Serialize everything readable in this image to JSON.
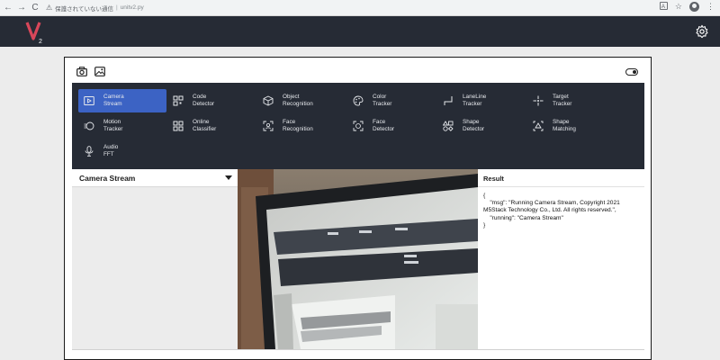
{
  "browser": {
    "back_icon": "←",
    "forward_icon": "→",
    "reload_icon": "C",
    "security_text": "保護されていない通信",
    "url": "unitv2.py"
  },
  "header": {
    "logo_subscript": "2"
  },
  "menu": {
    "items": [
      {
        "label": "Camera\nStream",
        "icon": "camera-stream-icon",
        "active": true
      },
      {
        "label": "Code\nDetector",
        "icon": "qr-code-icon",
        "active": false
      },
      {
        "label": "Object\nRecognition",
        "icon": "cube-icon",
        "active": false
      },
      {
        "label": "Color\nTracker",
        "icon": "palette-icon",
        "active": false
      },
      {
        "label": "LaneLine\nTracker",
        "icon": "lane-line-icon",
        "active": false
      },
      {
        "label": "Target\nTracker",
        "icon": "crosshair-icon",
        "active": false
      },
      {
        "label": "Motion\nTracker",
        "icon": "motion-icon",
        "active": false
      },
      {
        "label": "Online\nClassifier",
        "icon": "grid-icon",
        "active": false
      },
      {
        "label": "Face\nRecognition",
        "icon": "face-recognition-icon",
        "active": false
      },
      {
        "label": "Face\nDetector",
        "icon": "face-detector-icon",
        "active": false
      },
      {
        "label": "Shape\nDetector",
        "icon": "shapes-icon",
        "active": false
      },
      {
        "label": "Shape\nMatching",
        "icon": "shape-matching-icon",
        "active": false
      },
      {
        "label": "Audio\nFFT",
        "icon": "microphone-icon",
        "active": false
      }
    ]
  },
  "selector": {
    "value": "Camera Stream"
  },
  "result": {
    "title": "Result",
    "json_text": "{\n    \"msg\": \"Running Camera Stream, Copyright 2021\nM5Stack Technology Co., Ltd. All rights reserved.\",\n    \"running\": \"Camera Stream\"\n}"
  },
  "colors": {
    "header_bg": "#262b35",
    "menu_bg": "#262b35",
    "active_item": "#3c63c4",
    "logo_v": "#d9475a"
  }
}
